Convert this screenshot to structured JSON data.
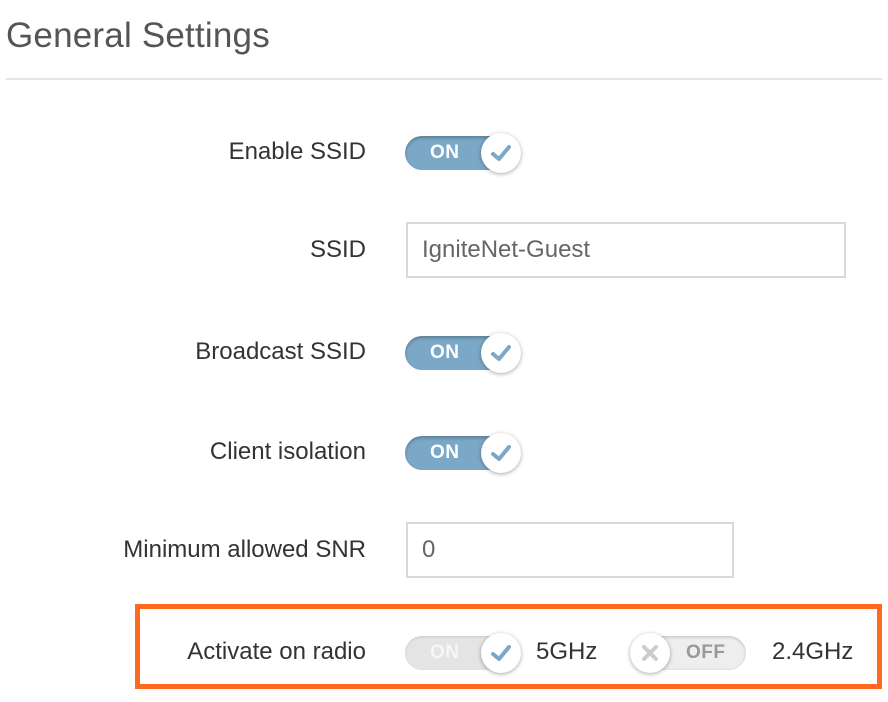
{
  "section": {
    "title": "General Settings"
  },
  "fields": {
    "enable_ssid": {
      "label": "Enable SSID",
      "state": "ON"
    },
    "ssid": {
      "label": "SSID",
      "value": "IgniteNet-Guest"
    },
    "broadcast_ssid": {
      "label": "Broadcast SSID",
      "state": "ON"
    },
    "client_isolation": {
      "label": "Client isolation",
      "state": "ON"
    },
    "min_snr": {
      "label": "Minimum allowed SNR",
      "value": "0"
    },
    "activate_on_radio": {
      "label": "Activate on radio",
      "radio_5ghz": {
        "state": "ON",
        "name": "5GHz",
        "disabled": true
      },
      "radio_24ghz": {
        "state": "OFF",
        "name": "2.4GHz"
      }
    }
  },
  "colors": {
    "toggle_on": "#7ba8c7",
    "check": "#7ba8c7",
    "highlight": "#ff6a1f",
    "rule": "#e5e5e5"
  },
  "icons": {
    "on_knob": "checkmark-icon",
    "off_knob": "x-icon"
  }
}
